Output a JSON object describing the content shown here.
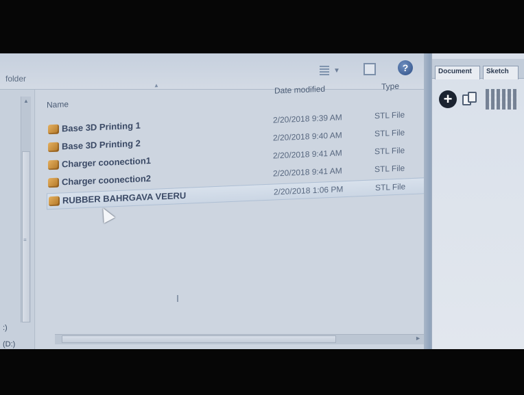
{
  "dialog": {
    "folder_label": "folder",
    "columns": {
      "name": "Name",
      "date_modified": "Date modified",
      "type": "Type"
    },
    "files": [
      {
        "name": "Base 3D Printing 1",
        "date": "2/20/2018 9:39 AM",
        "type": "STL File",
        "selected": false
      },
      {
        "name": "Base 3D Printing 2",
        "date": "2/20/2018 9:40 AM",
        "type": "STL File",
        "selected": false
      },
      {
        "name": "Charger coonection1",
        "date": "2/20/2018 9:41 AM",
        "type": "STL File",
        "selected": false
      },
      {
        "name": "Charger coonection2",
        "date": "2/20/2018 9:41 AM",
        "type": "STL File",
        "selected": false
      },
      {
        "name": "RUBBER BAHRGAVA VEERU",
        "date": "2/20/2018 1:06 PM",
        "type": "STL File",
        "selected": true
      }
    ],
    "nav_items": [
      ":)",
      "(D:)"
    ]
  },
  "app_pane": {
    "tabs": [
      "Document",
      "Sketch"
    ]
  },
  "colors": {
    "selection": "#cbd6e4",
    "help_icon": "#2e4f86",
    "file_icon": "#c98a38"
  }
}
